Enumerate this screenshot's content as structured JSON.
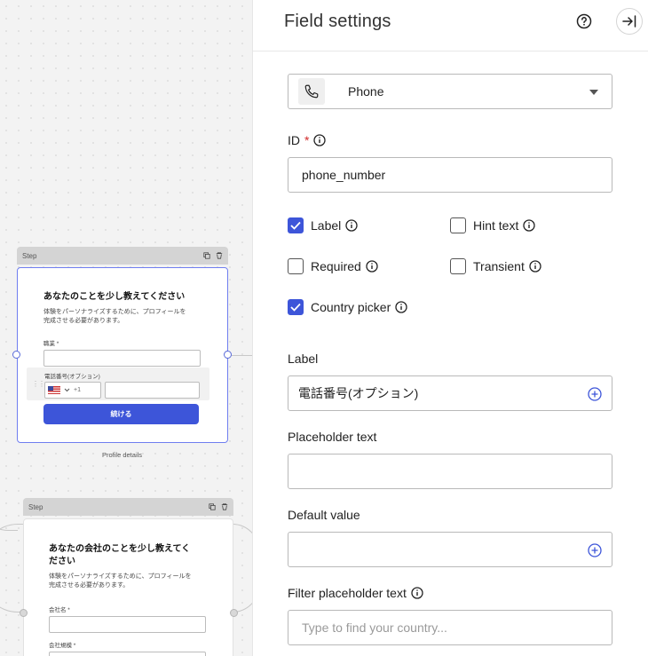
{
  "canvas": {
    "step1": {
      "header": "Step",
      "title": "あなたのことを少し教えてください",
      "subtitle_line1": "体験をパーソナライズするために、プロフィールを",
      "subtitle_line2": "完成させる必要があります。",
      "field1_label": "職業 *",
      "phone_label": "電話番号(オプション)",
      "dial_code": "+1",
      "button": "続ける",
      "caption": "Profile details"
    },
    "step2": {
      "header": "Step",
      "title_line1": "あなたの会社のことを少し教えてく",
      "title_line2": "ださい",
      "subtitle_line1": "体験をパーソナライズするために、プロフィールを",
      "subtitle_line2": "完成させる必要があります。",
      "field1_label": "会社名 *",
      "field2_label": "会社規模 *"
    }
  },
  "panel": {
    "title": "Field settings",
    "field_type": {
      "label": "Phone",
      "icon": "phone-icon"
    },
    "id_label": "ID",
    "id_required_mark": "*",
    "id_value": "phone_number",
    "checkboxes": {
      "label": {
        "text": "Label",
        "checked": true
      },
      "hint_text": {
        "text": "Hint text",
        "checked": false
      },
      "required": {
        "text": "Required",
        "checked": false
      },
      "transient": {
        "text": "Transient",
        "checked": false
      },
      "country_picker": {
        "text": "Country picker",
        "checked": true
      }
    },
    "label_section": {
      "title": "Label",
      "value": "電話番号(オプション)"
    },
    "placeholder_section": {
      "title": "Placeholder text",
      "value": ""
    },
    "default_section": {
      "title": "Default value",
      "value": ""
    },
    "filter_section": {
      "title": "Filter placeholder text",
      "placeholder": "Type to find your country..."
    },
    "colors": {
      "accent": "#3d55d9",
      "required": "#d12a2a"
    }
  }
}
